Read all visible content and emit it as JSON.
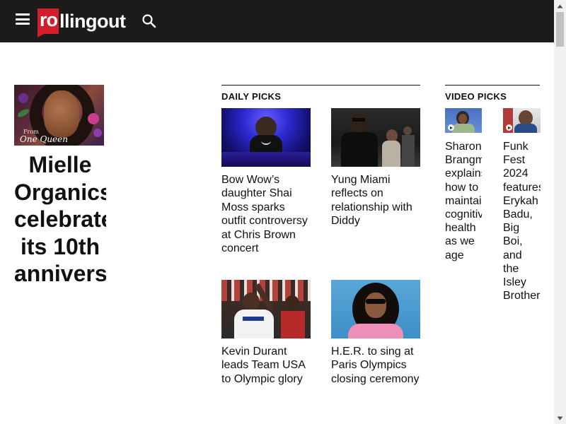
{
  "header": {
    "logo_badge": "ro",
    "logo_rest": "llingout",
    "menu_icon": "hamburger-menu-icon",
    "search_icon": "search-icon",
    "colors": {
      "bar": "#1b1b1b",
      "brand": "#d21e2b"
    }
  },
  "feature": {
    "image_caption_small": "From",
    "image_caption_script": "One Queen",
    "title_lines": [
      "Mielle",
      "Organics",
      "celebrates",
      "its 10th",
      "anniversary"
    ]
  },
  "daily_picks": {
    "label": "DAILY PICKS",
    "items": [
      {
        "title": "Bow Wow’s daughter Shai Moss sparks outfit controversy at Chris Brown concert"
      },
      {
        "title": "Yung Miami reflects on relationship with Diddy"
      },
      {
        "title": "Kevin Durant leads Team USA to Olympic glory"
      },
      {
        "title": "H.E.R. to sing at Paris Olympics closing ceremony"
      }
    ]
  },
  "video_picks": {
    "label": "VIDEO PICKS",
    "items": [
      {
        "title_lines": [
          "Sharon",
          "Brangman",
          "explains",
          "how to",
          "maintain",
          "cognitive",
          "health",
          "as we",
          "age"
        ]
      },
      {
        "title_lines": [
          "Funk",
          "Fest",
          "2024",
          "features",
          "Erykah",
          "Badu,",
          "Big",
          "Boi,",
          "and",
          "the",
          "Isley",
          "Brothers"
        ]
      }
    ]
  }
}
